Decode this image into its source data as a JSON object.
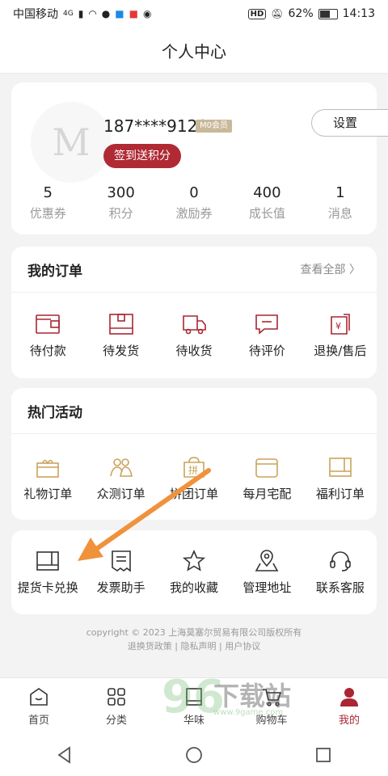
{
  "status_bar": {
    "carrier": "中国移动",
    "network": "4G",
    "hd": "HD",
    "battery": "62%",
    "time": "14:13"
  },
  "header": {
    "title": "个人中心"
  },
  "profile": {
    "avatar_letter": "M",
    "phone": "187****9128",
    "member_level": "M0会员",
    "checkin_label": "签到送积分",
    "settings_label": "设置",
    "stats": [
      {
        "value": "5",
        "label": "优惠券"
      },
      {
        "value": "300",
        "label": "积分"
      },
      {
        "value": "0",
        "label": "激励券"
      },
      {
        "value": "400",
        "label": "成长值"
      },
      {
        "value": "1",
        "label": "消息"
      }
    ]
  },
  "orders": {
    "title": "我的订单",
    "view_all": "查看全部 〉",
    "items": [
      {
        "label": "待付款",
        "icon": "wallet-icon"
      },
      {
        "label": "待发货",
        "icon": "package-icon"
      },
      {
        "label": "待收货",
        "icon": "truck-icon"
      },
      {
        "label": "待评价",
        "icon": "comment-icon"
      },
      {
        "label": "退换/售后",
        "icon": "refund-icon"
      }
    ]
  },
  "activities": {
    "title": "热门活动",
    "items": [
      {
        "label": "礼物订单",
        "icon": "gift-icon"
      },
      {
        "label": "众测订单",
        "icon": "users-icon"
      },
      {
        "label": "拼团订单",
        "icon": "group-buy-icon",
        "icon_text": "拼"
      },
      {
        "label": "每月宅配",
        "icon": "calendar-icon"
      },
      {
        "label": "福利订单",
        "icon": "welfare-icon"
      }
    ]
  },
  "services": {
    "items": [
      {
        "label": "提货卡兑换",
        "icon": "card-icon"
      },
      {
        "label": "发票助手",
        "icon": "invoice-icon"
      },
      {
        "label": "我的收藏",
        "icon": "star-icon"
      },
      {
        "label": "管理地址",
        "icon": "location-icon"
      },
      {
        "label": "联系客服",
        "icon": "headset-icon"
      }
    ]
  },
  "footer": {
    "copyright": "copyright © 2023 上海莫塞尔贸易有限公司版权所有",
    "links": "退换货政策 | 隐私声明 | 用户协议"
  },
  "tabs": [
    {
      "label": "首页",
      "icon": "home-icon"
    },
    {
      "label": "分类",
      "icon": "category-icon"
    },
    {
      "label": "华味",
      "icon": "book-icon"
    },
    {
      "label": "购物车",
      "icon": "cart-icon"
    },
    {
      "label": "我的",
      "icon": "user-icon",
      "active": true
    }
  ],
  "watermark": {
    "number": "96",
    "text": "下载站",
    "url": "www.9game.com"
  },
  "colors": {
    "accent": "#b02a34",
    "gold": "#c9a45c",
    "arrow": "#f0923c"
  }
}
